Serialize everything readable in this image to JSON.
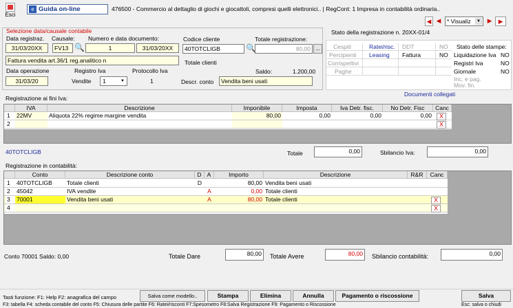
{
  "toolbar": {
    "esci": "Esci",
    "guida": "Guida on-line",
    "info": "476500 - Commercio al dettaglio di giochi e giocattoli, compresi quelli elettronici.. | RegCont: 1 Impresa  in contabilità ordinaria..",
    "visualizza": "* Visualiz"
  },
  "section1": {
    "title": "Selezione data/causale contabile"
  },
  "form": {
    "data_reg_label": "Data registraz.",
    "causale_label": "Causale:",
    "numero_data_label": "Numero e data documento:",
    "data_reg": "31/03/20XX",
    "causale": "FV13",
    "numero": "1",
    "data_doc": "31/03/20XX",
    "descrizione": "Fattura vendita art.36/1 reg.analitico n",
    "data_op_label": "Data operazione",
    "registro_label": "Registro Iva",
    "protocollo_label": "Protocollo Iva",
    "data_op": "31/03/20",
    "registro_value": "Vendite",
    "registro_num": "1",
    "protocollo": "1",
    "codice_cliente_label": "Codice cliente",
    "totale_reg_label": "Totale registrazione:",
    "codice_cliente": "40TOTCLIGB",
    "totale_reg": "80,00",
    "totale_clienti": "Totale clienti",
    "saldo_label": "Saldo:",
    "saldo": "1.200,00",
    "descr_conto_label": "Descr. conto",
    "descr_conto": "Vendita beni usati"
  },
  "stato": {
    "title": "Stato della registrazione n. 20XX-01/4",
    "rows": [
      [
        "Cespiti",
        "Ratei/risc.",
        "DDT",
        "NO"
      ],
      [
        "Percipienti",
        "Leasing",
        "Fattura",
        "NO"
      ],
      [
        "Corrispettivi",
        "",
        "",
        ""
      ],
      [
        "Paghe",
        "",
        "",
        ""
      ]
    ],
    "stampe_title": "Stato delle stampe:",
    "stampe": [
      [
        "Liquidazione Iva",
        "NO"
      ],
      [
        "Registri Iva",
        "NO"
      ],
      [
        "Giornale",
        "NO"
      ],
      [
        "Inc. e pag. Mov. fin.",
        ""
      ]
    ]
  },
  "iva": {
    "title": "Registrazione ai fini Iva:",
    "documenti": "Documenti collegati",
    "headers": [
      "IVA",
      "Descrizione",
      "Imponibile",
      "Imposta",
      "Iva Detr. fisc.",
      "No Detr. Fisc",
      "Canc"
    ],
    "rows": [
      {
        "n": "1",
        "iva": "22MV",
        "descr": "Aliquota 22% regime margine vendita",
        "imponibile": "80,00",
        "imposta": "0,00",
        "detr": "0,00",
        "nodetr": "0,00"
      },
      {
        "n": "2",
        "iva": "",
        "descr": "",
        "imponibile": "",
        "imposta": "",
        "detr": "",
        "nodetr": ""
      }
    ],
    "x": "X",
    "conto": "40TOTCLIGB",
    "totale_label": "Totale",
    "totale": "0,00",
    "sbilancio_label": "Sbilancio Iva:",
    "sbilancio": "0,00"
  },
  "contab": {
    "title": "Registrazione in contabilità:",
    "headers": [
      "Conto",
      "Descrizione conto",
      "D",
      "A",
      "Importo",
      "Descrizione",
      "R&R",
      "Canc"
    ],
    "rows": [
      {
        "n": "1",
        "conto": "40TOTCLIGB",
        "descr": "Totale clienti",
        "d": "D",
        "a": "",
        "importo": "80,00",
        "descr2": "Vendita beni usati"
      },
      {
        "n": "2",
        "conto": "45042",
        "descr": "IVA vendite",
        "d": "",
        "a": "A",
        "importo": "0,00",
        "descr2": "Totale clienti"
      },
      {
        "n": "3",
        "conto": "70001",
        "descr": "Vendita beni usati",
        "d": "",
        "a": "A",
        "importo": "80,00",
        "descr2": "Totale clienti"
      },
      {
        "n": "4",
        "conto": "",
        "descr": "",
        "d": "",
        "a": "",
        "importo": "",
        "descr2": ""
      }
    ]
  },
  "footer": {
    "conto_saldo": "Conto 70001 Saldo: 0,00",
    "totale_dare_label": "Totale Dare",
    "totale_dare": "80,00",
    "totale_avere_label": "Totale Avere",
    "totale_avere": "80,00",
    "sbilancio_label": "Sbilancio contabilità:",
    "sbilancio": "0,00"
  },
  "bottom": {
    "tasti": "Tasti funzione: F1: Help  F2: anagrafica del campo",
    "salva_modello": "Salva come modello..",
    "stampa": "Stampa",
    "elimina": "Elimina",
    "annulla": "Annulla",
    "pagamento": "Pagamento o riscossione",
    "salva": "Salva",
    "shortcuts": "F3: tabella  F4: scheda contabile del conto  F5: Chiusura delle partite     F6: Ratei/risconti   F7:Spesometro   F8:Salva Registrazione    F9: Pagamento o Riscossione",
    "esc": "Esc: salva o chiudi"
  }
}
